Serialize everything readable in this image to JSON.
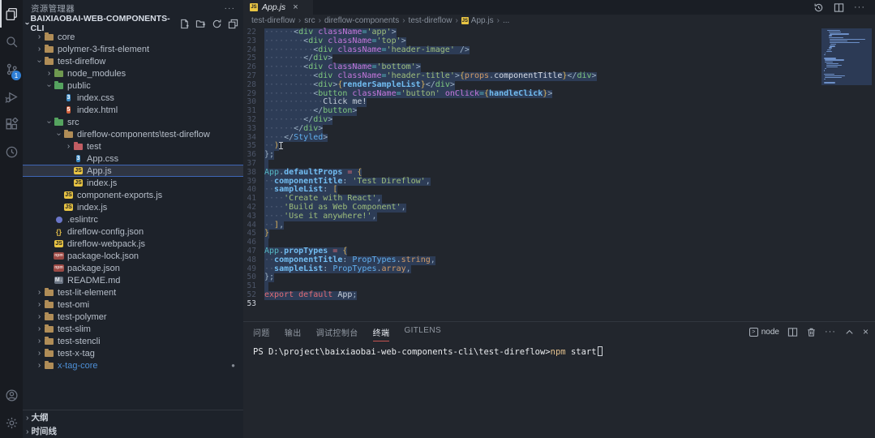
{
  "activity_bar": {
    "items": [
      {
        "name": "explorer",
        "active": true
      },
      {
        "name": "search",
        "active": false
      },
      {
        "name": "source-control",
        "active": false,
        "badge": "1"
      },
      {
        "name": "run-debug",
        "active": false
      },
      {
        "name": "extensions",
        "active": false
      },
      {
        "name": "history-extension",
        "active": false
      }
    ],
    "bottom": [
      {
        "name": "account"
      },
      {
        "name": "settings"
      }
    ]
  },
  "sidebar": {
    "title": "资源管理器",
    "more_label": "···",
    "project": "BAIXIAOBAI-WEB-COMPONENTS-CLI",
    "actions": [
      "new-file",
      "new-folder",
      "refresh",
      "collapse-all"
    ],
    "tree": [
      {
        "label": "core",
        "level": 1,
        "icon": "folder",
        "color": "#b08d57",
        "chev": "closed"
      },
      {
        "label": "polymer-3-first-element",
        "level": 1,
        "icon": "folder",
        "color": "#b08d57",
        "chev": "closed"
      },
      {
        "label": "test-direflow",
        "level": 1,
        "icon": "folder",
        "color": "#b08d57",
        "chev": "open"
      },
      {
        "label": "node_modules",
        "level": 2,
        "icon": "folder",
        "color": "#6f9950",
        "chev": "closed"
      },
      {
        "label": "public",
        "level": 2,
        "icon": "folder",
        "color": "#55a35f",
        "chev": "open"
      },
      {
        "label": "index.css",
        "level": 3,
        "icon": "css",
        "chev": "none"
      },
      {
        "label": "index.html",
        "level": 3,
        "icon": "html",
        "chev": "none"
      },
      {
        "label": "src",
        "level": 2,
        "icon": "folder",
        "color": "#55a35f",
        "chev": "open"
      },
      {
        "label": "direflow-components\\test-direflow",
        "level": 3,
        "icon": "folder",
        "color": "#b08d57",
        "chev": "open"
      },
      {
        "label": "test",
        "level": 4,
        "icon": "folder",
        "color": "#c25d63",
        "chev": "closed"
      },
      {
        "label": "App.css",
        "level": 4,
        "icon": "css",
        "chev": "none"
      },
      {
        "label": "App.js",
        "level": 4,
        "icon": "js",
        "chev": "none",
        "selected": true
      },
      {
        "label": "index.js",
        "level": 4,
        "icon": "js",
        "chev": "none"
      },
      {
        "label": "component-exports.js",
        "level": 3,
        "icon": "js",
        "chev": "none"
      },
      {
        "label": "index.js",
        "level": 3,
        "icon": "js",
        "chev": "none"
      },
      {
        "label": ".eslintrc",
        "level": 2,
        "icon": "eslint",
        "chev": "none"
      },
      {
        "label": "direflow-config.json",
        "level": 2,
        "icon": "json",
        "chev": "none"
      },
      {
        "label": "direflow-webpack.js",
        "level": 2,
        "icon": "js",
        "chev": "none"
      },
      {
        "label": "package-lock.json",
        "level": 2,
        "icon": "npm",
        "chev": "none"
      },
      {
        "label": "package.json",
        "level": 2,
        "icon": "npm",
        "chev": "none"
      },
      {
        "label": "README.md",
        "level": 2,
        "icon": "md",
        "chev": "none"
      },
      {
        "label": "test-lit-element",
        "level": 1,
        "icon": "folder",
        "color": "#b08d57",
        "chev": "closed"
      },
      {
        "label": "test-omi",
        "level": 1,
        "icon": "folder",
        "color": "#b08d57",
        "chev": "closed"
      },
      {
        "label": "test-polymer",
        "level": 1,
        "icon": "folder",
        "color": "#b08d57",
        "chev": "closed"
      },
      {
        "label": "test-slim",
        "level": 1,
        "icon": "folder",
        "color": "#b08d57",
        "chev": "closed"
      },
      {
        "label": "test-stencli",
        "level": 1,
        "icon": "folder",
        "color": "#b08d57",
        "chev": "closed"
      },
      {
        "label": "test-x-tag",
        "level": 1,
        "icon": "folder",
        "color": "#b08d57",
        "chev": "closed"
      },
      {
        "label": "x-tag-core",
        "level": 1,
        "icon": "folder",
        "color": "#b08d57",
        "chev": "closed",
        "label_color": "#4d8fd6",
        "gitdot": "●"
      }
    ],
    "bottom_sections": [
      {
        "label": "大纲"
      },
      {
        "label": "时间线"
      }
    ]
  },
  "editor": {
    "tab": {
      "label": "App.js",
      "close": "×"
    },
    "breadcrumb": [
      {
        "label": "test-direflow"
      },
      {
        "label": "src"
      },
      {
        "label": "direflow-components"
      },
      {
        "label": "test-direflow"
      },
      {
        "label": "App.js",
        "icon": "js"
      },
      {
        "label": "..."
      }
    ],
    "lines": [
      {
        "n": 22,
        "sel": true,
        "ws": 6,
        "t": [
          [
            "pun",
            "<"
          ],
          [
            "tag",
            "div"
          ],
          [
            "plain",
            " "
          ],
          [
            "attr",
            "className"
          ],
          [
            "op",
            "="
          ],
          [
            "str",
            "'app'"
          ],
          [
            "pun",
            ">"
          ]
        ]
      },
      {
        "n": 23,
        "sel": true,
        "ws": 8,
        "t": [
          [
            "pun",
            "<"
          ],
          [
            "tag",
            "div"
          ],
          [
            "plain",
            " "
          ],
          [
            "attr",
            "className"
          ],
          [
            "op",
            "="
          ],
          [
            "str",
            "'top'"
          ],
          [
            "pun",
            ">"
          ]
        ]
      },
      {
        "n": 24,
        "sel": true,
        "ws": 10,
        "t": [
          [
            "pun",
            "<"
          ],
          [
            "tag",
            "div"
          ],
          [
            "plain",
            " "
          ],
          [
            "attr",
            "className"
          ],
          [
            "op",
            "="
          ],
          [
            "str",
            "'header-image'"
          ],
          [
            "pun",
            " />"
          ]
        ]
      },
      {
        "n": 25,
        "sel": true,
        "ws": 8,
        "t": [
          [
            "pun",
            "</"
          ],
          [
            "tag",
            "div"
          ],
          [
            "pun",
            ">"
          ]
        ]
      },
      {
        "n": 26,
        "sel": true,
        "ws": 8,
        "t": [
          [
            "pun",
            "<"
          ],
          [
            "tag",
            "div"
          ],
          [
            "plain",
            " "
          ],
          [
            "attr",
            "className"
          ],
          [
            "op",
            "="
          ],
          [
            "str",
            "'bottom'"
          ],
          [
            "pun",
            ">"
          ]
        ]
      },
      {
        "n": 27,
        "sel": true,
        "ws": 10,
        "t": [
          [
            "pun",
            "<"
          ],
          [
            "tag",
            "div"
          ],
          [
            "plain",
            " "
          ],
          [
            "attr",
            "className"
          ],
          [
            "op",
            "="
          ],
          [
            "str",
            "'header-title'"
          ],
          [
            "pun",
            ">"
          ],
          [
            "brk",
            "{"
          ],
          [
            "var",
            "props"
          ],
          [
            "pun",
            "."
          ],
          [
            "mem",
            "componentTitle"
          ],
          [
            "brk",
            "}"
          ],
          [
            "pun",
            "</"
          ],
          [
            "tag",
            "div"
          ],
          [
            "pun",
            ">"
          ]
        ]
      },
      {
        "n": 28,
        "sel": true,
        "ws": 10,
        "t": [
          [
            "pun",
            "<"
          ],
          [
            "tag",
            "div"
          ],
          [
            "pun",
            ">"
          ],
          [
            "brk",
            "{"
          ],
          [
            "prop",
            "renderSampleList"
          ],
          [
            "brk",
            "}"
          ],
          [
            "pun",
            "</"
          ],
          [
            "tag",
            "div"
          ],
          [
            "pun",
            ">"
          ]
        ]
      },
      {
        "n": 29,
        "sel": true,
        "ws": 10,
        "t": [
          [
            "pun",
            "<"
          ],
          [
            "tag",
            "button"
          ],
          [
            "plain",
            " "
          ],
          [
            "attr",
            "className"
          ],
          [
            "op",
            "="
          ],
          [
            "str",
            "'button'"
          ],
          [
            "plain",
            " "
          ],
          [
            "attr",
            "onClick"
          ],
          [
            "op",
            "="
          ],
          [
            "brk",
            "{"
          ],
          [
            "prop",
            "handleClick"
          ],
          [
            "brk",
            "}"
          ],
          [
            "pun",
            ">"
          ]
        ]
      },
      {
        "n": 30,
        "sel": true,
        "ws": 12,
        "t": [
          [
            "plain",
            "Click me!"
          ]
        ]
      },
      {
        "n": 31,
        "sel": true,
        "ws": 10,
        "t": [
          [
            "pun",
            "</"
          ],
          [
            "tag",
            "button"
          ],
          [
            "pun",
            ">"
          ]
        ]
      },
      {
        "n": 32,
        "sel": true,
        "ws": 8,
        "t": [
          [
            "pun",
            "</"
          ],
          [
            "tag",
            "div"
          ],
          [
            "pun",
            ">"
          ]
        ]
      },
      {
        "n": 33,
        "sel": true,
        "ws": 6,
        "t": [
          [
            "pun",
            "</"
          ],
          [
            "tag",
            "div"
          ],
          [
            "pun",
            ">"
          ]
        ]
      },
      {
        "n": 34,
        "sel": true,
        "ws": 4,
        "t": [
          [
            "pun",
            "</"
          ],
          [
            "comp",
            "Styled"
          ],
          [
            "pun",
            ">"
          ]
        ]
      },
      {
        "n": 35,
        "sel": true,
        "ws": 2,
        "t": [
          [
            "brk",
            ")"
          ]
        ],
        "ibeam": true
      },
      {
        "n": 36,
        "sel": true,
        "ws": 0,
        "t": [
          [
            "pun",
            "};"
          ]
        ]
      },
      {
        "n": 37,
        "sel": true,
        "ws": 0,
        "t": []
      },
      {
        "n": 38,
        "sel": true,
        "ws": 0,
        "t": [
          [
            "op",
            "App"
          ],
          [
            "pun",
            "."
          ],
          [
            "prop",
            "defaultProps"
          ],
          [
            "kw",
            " = "
          ],
          [
            "brk",
            "{"
          ]
        ]
      },
      {
        "n": 39,
        "sel": true,
        "ws": 2,
        "t": [
          [
            "prop",
            "componentTitle"
          ],
          [
            "pun",
            ": "
          ],
          [
            "str",
            "'Test Direflow'"
          ],
          [
            "pun",
            ","
          ]
        ]
      },
      {
        "n": 40,
        "sel": true,
        "ws": 2,
        "t": [
          [
            "prop",
            "sampleList"
          ],
          [
            "pun",
            ": "
          ],
          [
            "brk",
            "["
          ]
        ]
      },
      {
        "n": 41,
        "sel": true,
        "ws": 4,
        "t": [
          [
            "str",
            "'Create with React'"
          ],
          [
            "pun",
            ","
          ]
        ]
      },
      {
        "n": 42,
        "sel": true,
        "ws": 4,
        "t": [
          [
            "str",
            "'Build as Web Component'"
          ],
          [
            "pun",
            ","
          ]
        ]
      },
      {
        "n": 43,
        "sel": true,
        "ws": 4,
        "t": [
          [
            "str",
            "'Use it anywhere!'"
          ],
          [
            "pun",
            ","
          ]
        ]
      },
      {
        "n": 44,
        "sel": true,
        "ws": 2,
        "t": [
          [
            "brk",
            "]"
          ],
          [
            "pun",
            ","
          ]
        ]
      },
      {
        "n": 45,
        "sel": true,
        "ws": 0,
        "t": [
          [
            "brk",
            "}"
          ]
        ]
      },
      {
        "n": 46,
        "sel": true,
        "ws": 0,
        "t": []
      },
      {
        "n": 47,
        "sel": true,
        "ws": 0,
        "t": [
          [
            "op",
            "App"
          ],
          [
            "pun",
            "."
          ],
          [
            "prop",
            "propTypes"
          ],
          [
            "kw",
            " = "
          ],
          [
            "brk",
            "{"
          ]
        ]
      },
      {
        "n": 48,
        "sel": true,
        "ws": 2,
        "t": [
          [
            "prop",
            "componentTitle"
          ],
          [
            "pun",
            ": "
          ],
          [
            "comp",
            "PropTypes"
          ],
          [
            "pun",
            "."
          ],
          [
            "var",
            "string"
          ],
          [
            "pun",
            ","
          ]
        ]
      },
      {
        "n": 49,
        "sel": true,
        "ws": 2,
        "t": [
          [
            "prop",
            "sampleList"
          ],
          [
            "pun",
            ": "
          ],
          [
            "comp",
            "PropTypes"
          ],
          [
            "pun",
            "."
          ],
          [
            "var",
            "array"
          ],
          [
            "pun",
            ","
          ]
        ]
      },
      {
        "n": 50,
        "sel": true,
        "ws": 0,
        "t": [
          [
            "pun",
            "};"
          ]
        ]
      },
      {
        "n": 51,
        "sel": true,
        "ws": 0,
        "t": []
      },
      {
        "n": 52,
        "sel": true,
        "ws": 0,
        "t": [
          [
            "kw",
            "export"
          ],
          [
            "plain",
            " "
          ],
          [
            "kw",
            "default"
          ],
          [
            "plain",
            " "
          ],
          [
            "plain",
            "App"
          ],
          [
            "pun",
            ";"
          ]
        ]
      },
      {
        "n": 53,
        "sel": false,
        "ws": 0,
        "t": [],
        "current": true
      }
    ]
  },
  "panel": {
    "tabs": [
      {
        "label": "问题",
        "active": false
      },
      {
        "label": "输出",
        "active": false
      },
      {
        "label": "调试控制台",
        "active": false
      },
      {
        "label": "终端",
        "active": true
      },
      {
        "label": "GITLENS",
        "active": false
      }
    ],
    "shell": "node",
    "terminal": {
      "prompt": "PS D:\\project\\baixiaobai-web-components-cli\\test-direflow>",
      "command": "npm",
      "args": " start"
    }
  }
}
